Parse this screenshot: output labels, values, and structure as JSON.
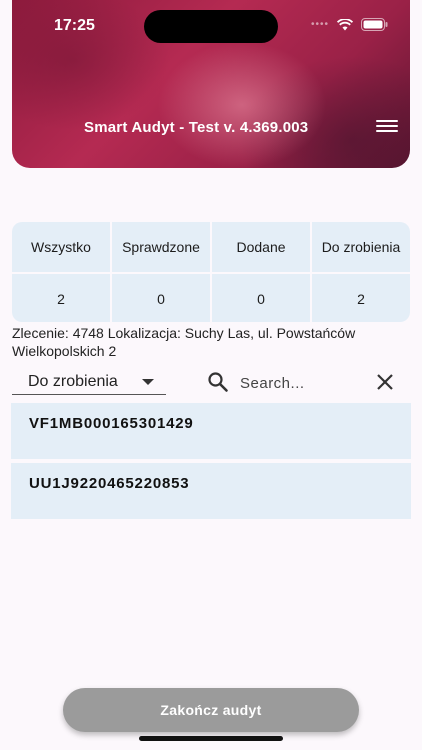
{
  "status_bar": {
    "time": "17:25"
  },
  "header": {
    "title": "Smart Audyt - Test v. 4.369.003"
  },
  "stats": {
    "columns": [
      {
        "label": "Wszystko",
        "value": "2"
      },
      {
        "label": "Sprawdzone",
        "value": "0"
      },
      {
        "label": "Dodane",
        "value": "0"
      },
      {
        "label": "Do zrobienia",
        "value": "2"
      }
    ]
  },
  "location": {
    "text": "Zlecenie: 4748  Lokalizacja: Suchy Las, ul. Powstańców Wielkopolskich 2"
  },
  "filter": {
    "selected": "Do zrobienia",
    "search_placeholder": "Search..."
  },
  "items": [
    {
      "code": "VF1MB000165301429"
    },
    {
      "code": "UU1J9220465220853"
    }
  ],
  "footer": {
    "finish_label": "Zakończ audyt"
  }
}
